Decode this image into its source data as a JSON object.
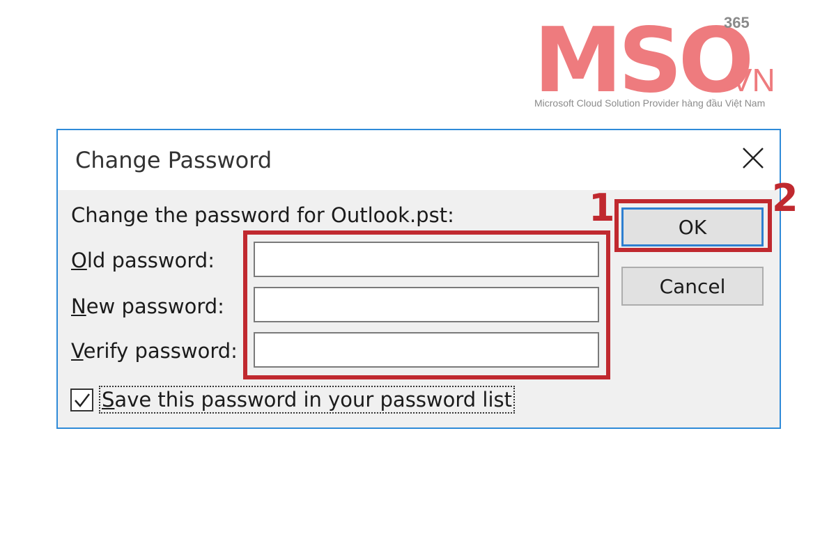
{
  "brand": {
    "logo_text": "MSO",
    "superscript": "365",
    "domain_suffix": ".VN",
    "tagline": "Microsoft Cloud Solution Provider hàng đầu Việt Nam",
    "color": "#ee7b7e"
  },
  "dialog": {
    "title": "Change Password",
    "close_icon": "close-icon",
    "prompt": "Change the password for Outlook.pst:",
    "fields": {
      "old": {
        "mnemonic": "O",
        "label_rest": "ld password:",
        "value": ""
      },
      "new": {
        "mnemonic": "N",
        "label_rest": "ew password:",
        "value": ""
      },
      "verify": {
        "mnemonic": "V",
        "label_rest": "erify password:",
        "value": ""
      }
    },
    "ok_label": "OK",
    "cancel_label": "Cancel",
    "save_checkbox": {
      "checked": true,
      "mnemonic": "S",
      "label_rest": "ave this password in your password list"
    },
    "accent_color": "#2e8ad8"
  },
  "annotations": {
    "step1": "1",
    "step2": "2",
    "color": "#c0292f"
  }
}
